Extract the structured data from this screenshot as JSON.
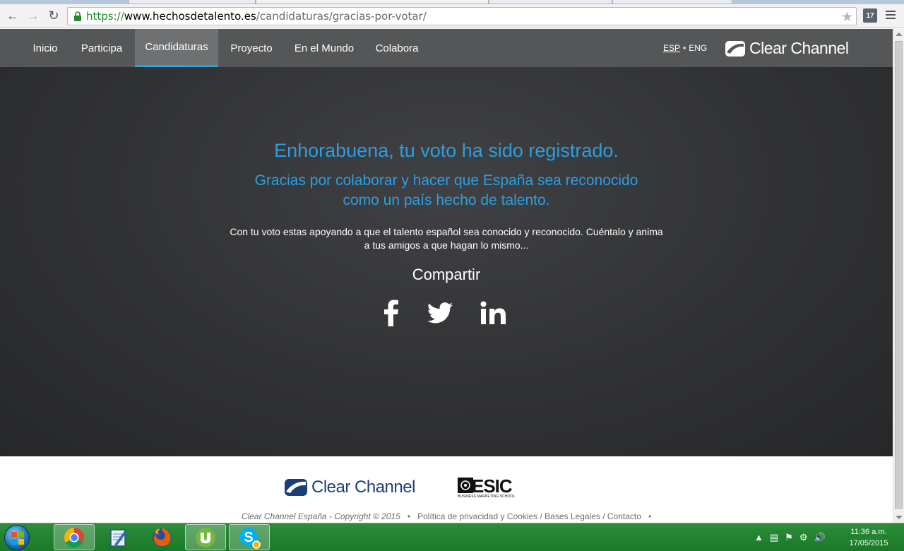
{
  "browser": {
    "url_scheme": "https://",
    "url_host": "www.hechosdetalento.es",
    "url_path": "/candidaturas/gracias-por-votar/",
    "extension_badge": "17"
  },
  "site": {
    "nav": [
      {
        "label": "Inicio",
        "active": false
      },
      {
        "label": "Participa",
        "active": false
      },
      {
        "label": "Candidaturas",
        "active": true
      },
      {
        "label": "Proyecto",
        "active": false
      },
      {
        "label": "En el Mundo",
        "active": false
      },
      {
        "label": "Colabora",
        "active": false
      }
    ],
    "lang_esp": "ESP",
    "lang_sep": "•",
    "lang_eng": "ENG",
    "logo_text": "Clear Channel"
  },
  "hero": {
    "title": "Enhorabuena, tu voto ha sido registrado.",
    "subtitle_line1": "Gracias por colaborar y hacer que España sea reconocido",
    "subtitle_line2": "como un país hecho de talento.",
    "body_line1": "Con tu voto estas apoyando a que el talento español sea conocido y reconocido. Cuéntalo y anima",
    "body_line2": "a tus amigos a que hagan lo mismo...",
    "share_title": "Compartir",
    "social": [
      "facebook-icon",
      "twitter-icon",
      "linkedin-icon"
    ]
  },
  "footer": {
    "cc_logo_text": "Clear Channel",
    "esic_logo_text": "ESIC",
    "esic_tagline": "BUSINESS MARKETING SCHOOL",
    "owner": "Clear Channel España - Copyright © 2015",
    "sep": "•",
    "links": "Política de privacidad y Cookies / Bases Legales / Contacto",
    "trailing_sep": "•"
  },
  "taskbar": {
    "apps": [
      "chrome-icon",
      "notepad-icon",
      "firefox-icon",
      "utorrent-icon",
      "skype-icon"
    ],
    "time": "11:36 a.m.",
    "date": "17/05/2015"
  },
  "colors": {
    "accent": "#2c9ee0",
    "nav_bg": "#555657",
    "nav_active_bar": "#27a3e2",
    "footer_logo": "#1a3f78",
    "taskbar": "#187a27"
  }
}
